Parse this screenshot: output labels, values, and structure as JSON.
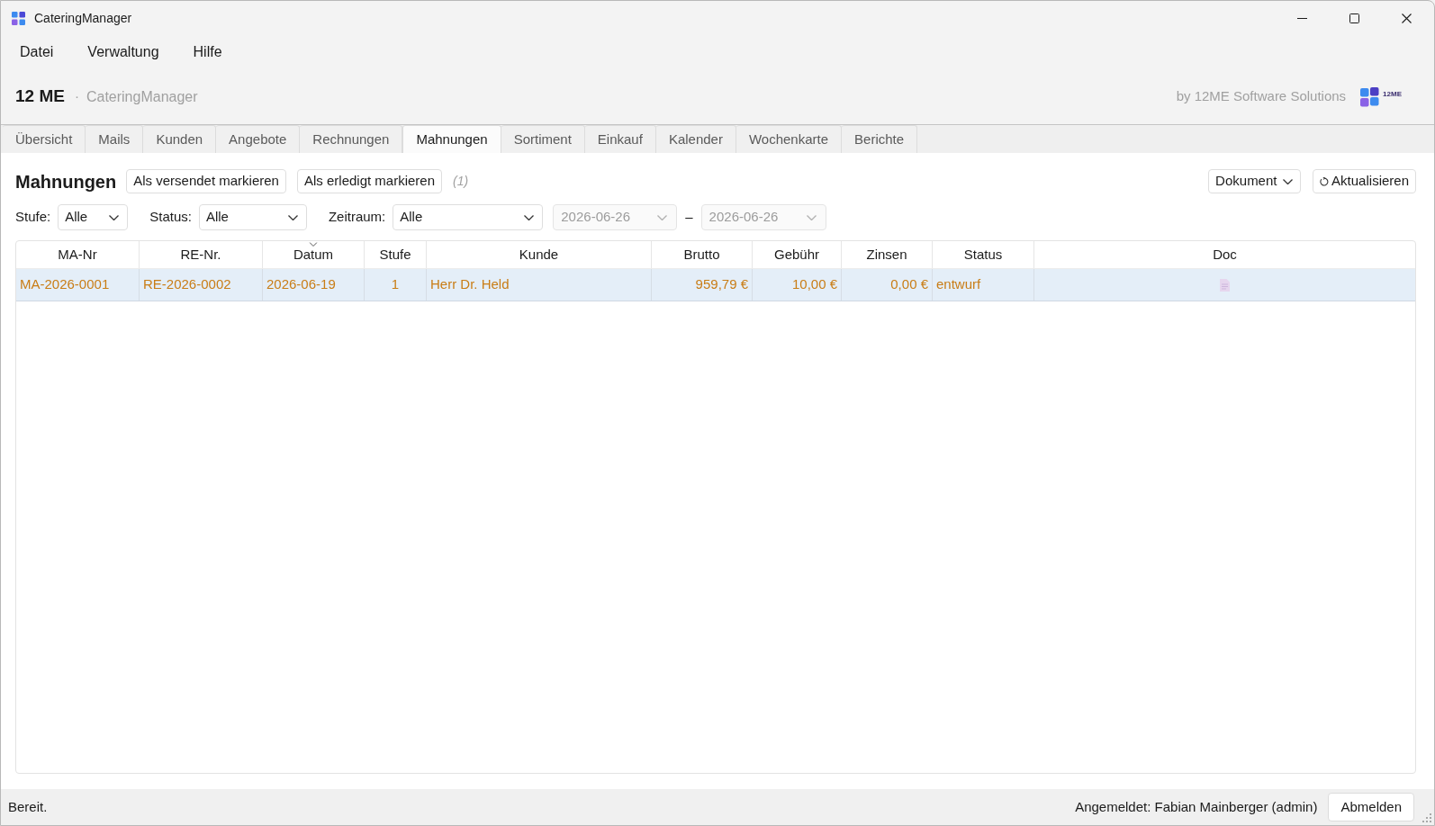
{
  "window": {
    "title": "CateringManager"
  },
  "menu": [
    {
      "label": "Datei"
    },
    {
      "label": "Verwaltung"
    },
    {
      "label": "Hilfe"
    }
  ],
  "header": {
    "brand": "12 ME",
    "separator": "·",
    "app_name": "CateringManager",
    "vendor": "by 12ME Software Solutions",
    "logo_text": "12ME"
  },
  "tabs": [
    {
      "label": "Übersicht",
      "selected": false
    },
    {
      "label": "Mails",
      "selected": false
    },
    {
      "label": "Kunden",
      "selected": false
    },
    {
      "label": "Angebote",
      "selected": false
    },
    {
      "label": "Rechnungen",
      "selected": false
    },
    {
      "label": "Mahnungen",
      "selected": true
    },
    {
      "label": "Sortiment",
      "selected": false
    },
    {
      "label": "Einkauf",
      "selected": false
    },
    {
      "label": "Kalender",
      "selected": false
    },
    {
      "label": "Wochenkarte",
      "selected": false
    },
    {
      "label": "Berichte",
      "selected": false
    }
  ],
  "toolbar": {
    "title": "Mahnungen",
    "actions": [
      {
        "label": "Als versendet markieren"
      },
      {
        "label": "Als erledigt markieren"
      }
    ],
    "count": "(1)",
    "document_select": {
      "value": "Dokument"
    },
    "refresh_button": {
      "label": "Aktualisieren"
    }
  },
  "filters": [
    {
      "label": "Stufe:",
      "value": "Alle"
    },
    {
      "label": "Status:",
      "value": "Alle"
    },
    {
      "label": "Zeitraum:",
      "value": "Alle"
    }
  ],
  "date_range": {
    "from": {
      "value": "2026-06-26",
      "disabled": true
    },
    "separator": "–",
    "to": {
      "value": "2026-06-26",
      "disabled": true
    }
  },
  "table": {
    "columns": [
      {
        "label": "MA-Nr",
        "sorted": false
      },
      {
        "label": "RE-Nr.",
        "sorted": false
      },
      {
        "label": "Datum",
        "sorted": true
      },
      {
        "label": "Stufe",
        "sorted": false
      },
      {
        "label": "Kunde",
        "sorted": false
      },
      {
        "label": "Brutto",
        "sorted": false
      },
      {
        "label": "Gebühr",
        "sorted": false
      },
      {
        "label": "Zinsen",
        "sorted": false
      },
      {
        "label": "Status",
        "sorted": false
      },
      {
        "label": "Doc",
        "sorted": false
      }
    ],
    "rows": [
      {
        "selected": true,
        "document": true,
        "cells": [
          "MA-2026-0001",
          "RE-2026-0002",
          "2026-06-19",
          "1",
          "Herr Dr. Held",
          "959,79 €",
          "10,00 €",
          "0,00 €",
          "entwurf"
        ]
      }
    ]
  },
  "status_bar": {
    "message": "Bereit.",
    "user": "Angemeldet: Fabian Mainberger (admin)",
    "logout_button": "Abmelden"
  }
}
